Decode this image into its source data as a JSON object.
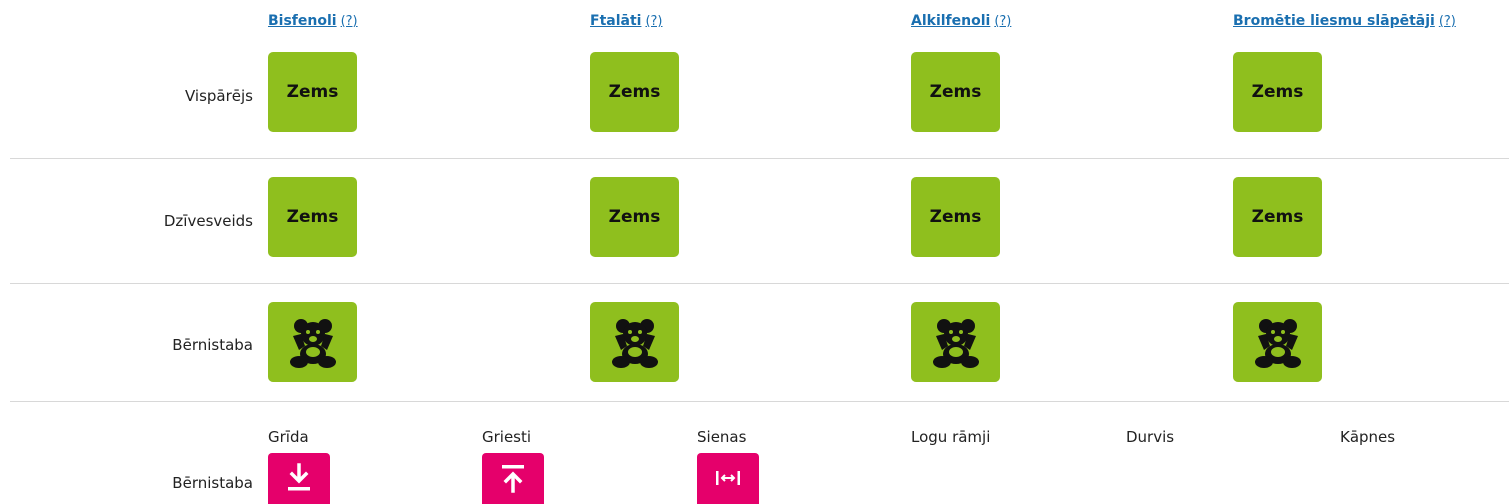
{
  "columns": [
    {
      "name": "Bisfenoli",
      "help": "(?)"
    },
    {
      "name": "Ftalāti",
      "help": "(?)"
    },
    {
      "name": "Alkilfenoli",
      "help": "(?)"
    },
    {
      "name": "Bromētie liesmu slāpētāji",
      "help": "(?)"
    }
  ],
  "rows": [
    {
      "label": "Vispārējs",
      "values": [
        "Zems",
        "Zems",
        "Zems",
        "Zems"
      ]
    },
    {
      "label": "Dzīvesveids",
      "values": [
        "Zems",
        "Zems",
        "Zems",
        "Zems"
      ]
    },
    {
      "label": "Bērnistaba",
      "icons": [
        "teddy-bear-icon",
        "teddy-bear-icon",
        "teddy-bear-icon",
        "teddy-bear-icon"
      ]
    }
  ],
  "room_row": {
    "label": "Bērnistaba",
    "items": [
      {
        "label": "Grīda",
        "icon": "arrow-down-to-floor-icon"
      },
      {
        "label": "Griesti",
        "icon": "arrow-up-to-ceiling-icon"
      },
      {
        "label": "Sienas",
        "icon": "arrows-between-walls-icon"
      },
      {
        "label": "Logu rāmji"
      },
      {
        "label": "Durvis"
      },
      {
        "label": "Kāpnes"
      }
    ]
  },
  "colors": {
    "badge": "#8fbf1e",
    "accent": "#e5006b",
    "link": "#1a6fb0"
  }
}
